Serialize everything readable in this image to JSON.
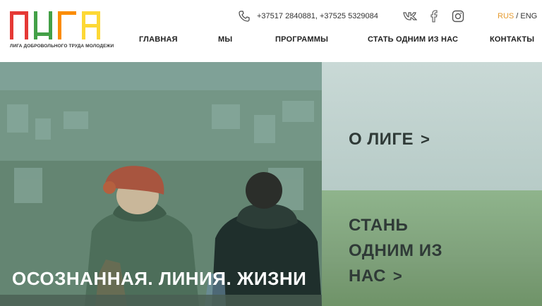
{
  "logo": {
    "sub": "ЛИГА ДОБРОВОЛЬНОГО ТРУДА МОЛОДЕЖИ",
    "colors": [
      "#e53935",
      "#43a047",
      "#fb8c00",
      "#fdd835"
    ]
  },
  "contact": {
    "icon": "phone-icon",
    "phones": "+37517 2840881, +37525 5329084"
  },
  "social": [
    "vk-icon",
    "facebook-icon",
    "instagram-icon"
  ],
  "lang": {
    "active": "RUS",
    "separator": " / ",
    "other": "ENG"
  },
  "nav": {
    "home": "ГЛАВНАЯ",
    "about": "МЫ",
    "programs": "ПРОГРАММЫ",
    "join": "СТАТЬ ОДНИМ ИЗ НАС",
    "contacts": "КОНТАКТЫ"
  },
  "hero": {
    "title": "ОСОЗНАННАЯ. ЛИНИЯ. ЖИЗНИ",
    "panel_top": {
      "label": "О ЛИГЕ",
      "arrow": ">"
    },
    "panel_bottom": {
      "line1": "СТАНЬ",
      "line2": "ОДНИМ ИЗ",
      "line3": "НАС",
      "arrow": ">"
    }
  }
}
